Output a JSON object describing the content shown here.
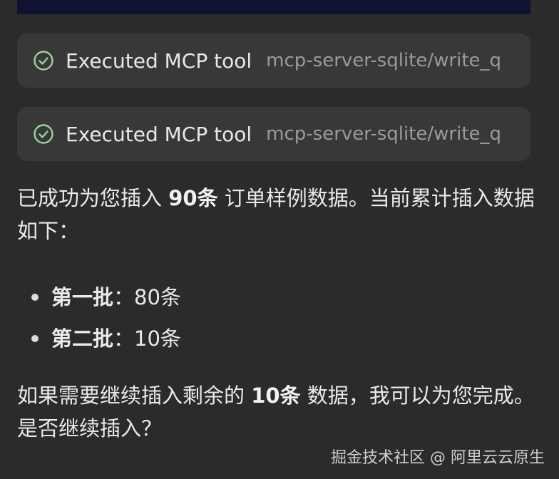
{
  "tool_calls": [
    {
      "label": "Executed MCP tool",
      "tool_name": "mcp-server-sqlite/write_q",
      "status_icon": "check-circle-icon"
    },
    {
      "label": "Executed MCP tool",
      "tool_name": "mcp-server-sqlite/write_q",
      "status_icon": "check-circle-icon"
    }
  ],
  "message": {
    "line1_prefix": "已成功为您插入 ",
    "line1_bold": "90条",
    "line1_suffix": " 订单样例数据。当前累计插入数据如下：",
    "batches": [
      {
        "label": "第一批",
        "sep": "：",
        "value": "80条"
      },
      {
        "label": "第二批",
        "sep": "：",
        "value": "10条"
      }
    ],
    "line2_prefix": "如果需要继续插入剩余的 ",
    "line2_bold": "10条",
    "line2_suffix": " 数据，我可以为您完成。是否继续插入？"
  },
  "watermark": "掘金技术社区 @ 阿里云云原生",
  "colors": {
    "background": "#2b2b2b",
    "card": "#383838",
    "check_icon": "#9bd39b",
    "top_block": "#0f1230"
  }
}
